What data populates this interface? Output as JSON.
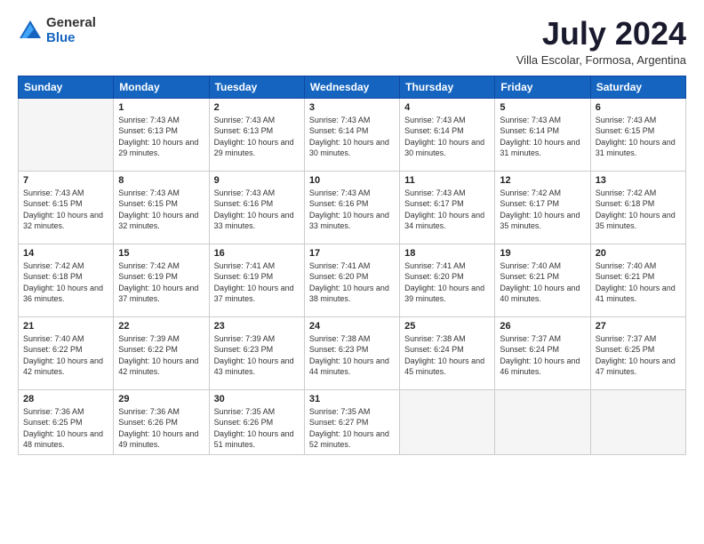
{
  "logo": {
    "general": "General",
    "blue": "Blue"
  },
  "title": "July 2024",
  "subtitle": "Villa Escolar, Formosa, Argentina",
  "weekdays": [
    "Sunday",
    "Monday",
    "Tuesday",
    "Wednesday",
    "Thursday",
    "Friday",
    "Saturday"
  ],
  "weeks": [
    [
      {
        "day": "",
        "empty": true
      },
      {
        "day": "1",
        "sunrise": "7:43 AM",
        "sunset": "6:13 PM",
        "daylight": "10 hours and 29 minutes."
      },
      {
        "day": "2",
        "sunrise": "7:43 AM",
        "sunset": "6:13 PM",
        "daylight": "10 hours and 29 minutes."
      },
      {
        "day": "3",
        "sunrise": "7:43 AM",
        "sunset": "6:14 PM",
        "daylight": "10 hours and 30 minutes."
      },
      {
        "day": "4",
        "sunrise": "7:43 AM",
        "sunset": "6:14 PM",
        "daylight": "10 hours and 30 minutes."
      },
      {
        "day": "5",
        "sunrise": "7:43 AM",
        "sunset": "6:14 PM",
        "daylight": "10 hours and 31 minutes."
      },
      {
        "day": "6",
        "sunrise": "7:43 AM",
        "sunset": "6:15 PM",
        "daylight": "10 hours and 31 minutes."
      }
    ],
    [
      {
        "day": "7",
        "sunrise": "7:43 AM",
        "sunset": "6:15 PM",
        "daylight": "10 hours and 32 minutes."
      },
      {
        "day": "8",
        "sunrise": "7:43 AM",
        "sunset": "6:15 PM",
        "daylight": "10 hours and 32 minutes."
      },
      {
        "day": "9",
        "sunrise": "7:43 AM",
        "sunset": "6:16 PM",
        "daylight": "10 hours and 33 minutes."
      },
      {
        "day": "10",
        "sunrise": "7:43 AM",
        "sunset": "6:16 PM",
        "daylight": "10 hours and 33 minutes."
      },
      {
        "day": "11",
        "sunrise": "7:43 AM",
        "sunset": "6:17 PM",
        "daylight": "10 hours and 34 minutes."
      },
      {
        "day": "12",
        "sunrise": "7:42 AM",
        "sunset": "6:17 PM",
        "daylight": "10 hours and 35 minutes."
      },
      {
        "day": "13",
        "sunrise": "7:42 AM",
        "sunset": "6:18 PM",
        "daylight": "10 hours and 35 minutes."
      }
    ],
    [
      {
        "day": "14",
        "sunrise": "7:42 AM",
        "sunset": "6:18 PM",
        "daylight": "10 hours and 36 minutes."
      },
      {
        "day": "15",
        "sunrise": "7:42 AM",
        "sunset": "6:19 PM",
        "daylight": "10 hours and 37 minutes."
      },
      {
        "day": "16",
        "sunrise": "7:41 AM",
        "sunset": "6:19 PM",
        "daylight": "10 hours and 37 minutes."
      },
      {
        "day": "17",
        "sunrise": "7:41 AM",
        "sunset": "6:20 PM",
        "daylight": "10 hours and 38 minutes."
      },
      {
        "day": "18",
        "sunrise": "7:41 AM",
        "sunset": "6:20 PM",
        "daylight": "10 hours and 39 minutes."
      },
      {
        "day": "19",
        "sunrise": "7:40 AM",
        "sunset": "6:21 PM",
        "daylight": "10 hours and 40 minutes."
      },
      {
        "day": "20",
        "sunrise": "7:40 AM",
        "sunset": "6:21 PM",
        "daylight": "10 hours and 41 minutes."
      }
    ],
    [
      {
        "day": "21",
        "sunrise": "7:40 AM",
        "sunset": "6:22 PM",
        "daylight": "10 hours and 42 minutes."
      },
      {
        "day": "22",
        "sunrise": "7:39 AM",
        "sunset": "6:22 PM",
        "daylight": "10 hours and 42 minutes."
      },
      {
        "day": "23",
        "sunrise": "7:39 AM",
        "sunset": "6:23 PM",
        "daylight": "10 hours and 43 minutes."
      },
      {
        "day": "24",
        "sunrise": "7:38 AM",
        "sunset": "6:23 PM",
        "daylight": "10 hours and 44 minutes."
      },
      {
        "day": "25",
        "sunrise": "7:38 AM",
        "sunset": "6:24 PM",
        "daylight": "10 hours and 45 minutes."
      },
      {
        "day": "26",
        "sunrise": "7:37 AM",
        "sunset": "6:24 PM",
        "daylight": "10 hours and 46 minutes."
      },
      {
        "day": "27",
        "sunrise": "7:37 AM",
        "sunset": "6:25 PM",
        "daylight": "10 hours and 47 minutes."
      }
    ],
    [
      {
        "day": "28",
        "sunrise": "7:36 AM",
        "sunset": "6:25 PM",
        "daylight": "10 hours and 48 minutes."
      },
      {
        "day": "29",
        "sunrise": "7:36 AM",
        "sunset": "6:26 PM",
        "daylight": "10 hours and 49 minutes."
      },
      {
        "day": "30",
        "sunrise": "7:35 AM",
        "sunset": "6:26 PM",
        "daylight": "10 hours and 51 minutes."
      },
      {
        "day": "31",
        "sunrise": "7:35 AM",
        "sunset": "6:27 PM",
        "daylight": "10 hours and 52 minutes."
      },
      {
        "day": "",
        "empty": true
      },
      {
        "day": "",
        "empty": true
      },
      {
        "day": "",
        "empty": true
      }
    ]
  ]
}
